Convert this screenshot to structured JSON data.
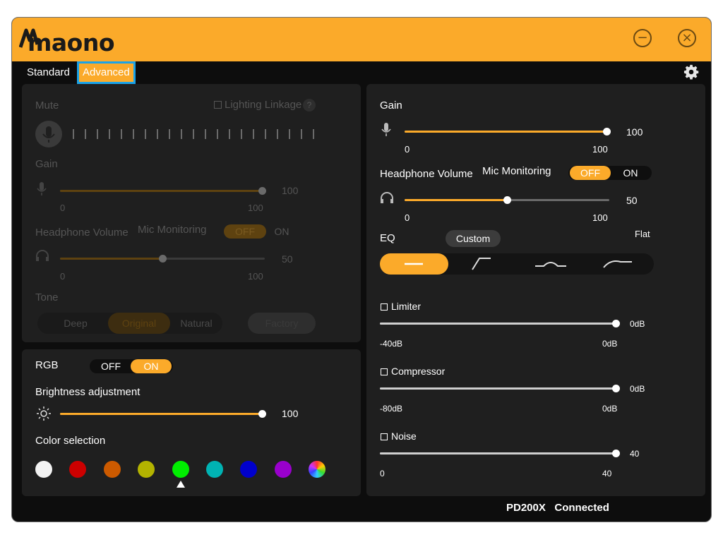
{
  "app": {
    "brand": "maono"
  },
  "tabs": {
    "standard": "Standard",
    "advanced": "Advanced"
  },
  "colors": {
    "accent": "#fbaa2a",
    "panel": "#1f1f1f",
    "background": "#0d0d0d",
    "focus": "#1aa3e8"
  },
  "disabled_panel": {
    "mute_label": "Mute",
    "lighting_linkage_label": "Lighting Linkage",
    "help": "?",
    "gain_label": "Gain",
    "gain_value": "100",
    "gain_min": "0",
    "gain_max": "100",
    "headphone_volume_label": "Headphone Volume",
    "mic_monitoring_label": "Mic Monitoring",
    "monitoring_off": "OFF",
    "monitoring_on": "ON",
    "headphone_value": "50",
    "headphone_min": "0",
    "headphone_max": "100",
    "tone_label": "Tone",
    "tone_options": [
      "Deep",
      "Original",
      "Natural"
    ],
    "tone_selected": "Original",
    "factory_label": "Factory"
  },
  "rgb": {
    "label": "RGB",
    "off": "OFF",
    "on": "ON",
    "state": "ON",
    "brightness_label": "Brightness adjustment",
    "brightness_value": "100",
    "color_selection_label": "Color selection",
    "swatches": [
      "#f2f2f2",
      "#cc0000",
      "#cc5a00",
      "#b3b300",
      "#00ee00",
      "#00b3b3",
      "#0000cc",
      "#9900cc",
      "multicolor"
    ],
    "selected_swatch": 4
  },
  "advanced": {
    "gain_label": "Gain",
    "gain_value": "100",
    "gain_min": "0",
    "gain_max": "100",
    "headphone_volume_label": "Headphone Volume",
    "mic_monitoring_label": "Mic Monitoring",
    "monitoring_off": "OFF",
    "monitoring_on": "ON",
    "monitoring_state": "OFF",
    "headphone_value": "50",
    "headphone_min": "0",
    "headphone_max": "100",
    "eq_label": "EQ",
    "eq_preset": "Custom",
    "eq_flat_label": "Flat",
    "limiter_label": "Limiter",
    "limiter_value": "0dB",
    "limiter_min": "-40dB",
    "limiter_max": "0dB",
    "compressor_label": "Compressor",
    "compressor_value": "0dB",
    "compressor_min": "-80dB",
    "compressor_max": "0dB",
    "noise_label": "Noise",
    "noise_value": "40",
    "noise_min": "0",
    "noise_max": "40"
  },
  "status": {
    "device": "PD200X",
    "state": "Connected"
  }
}
